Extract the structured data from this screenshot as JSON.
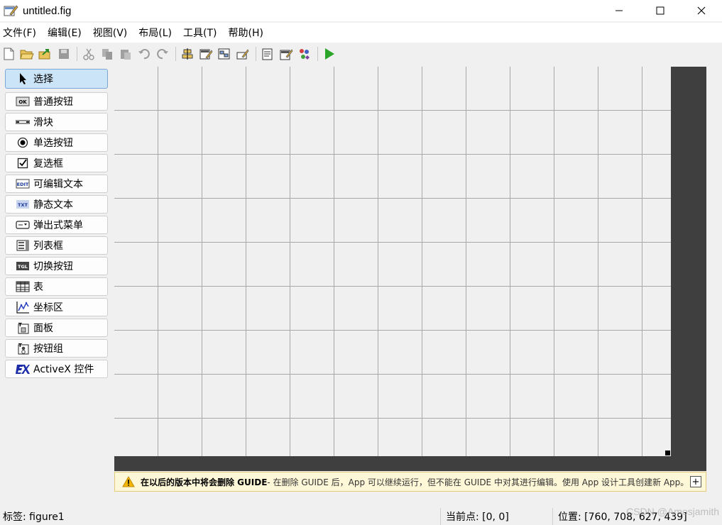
{
  "window": {
    "title": "untitled.fig"
  },
  "menu": [
    "文件(F)",
    "编辑(E)",
    "视图(V)",
    "布局(L)",
    "工具(T)",
    "帮助(H)"
  ],
  "palette": {
    "items": [
      {
        "label": "选择",
        "icon": "arrow-pointer-icon"
      },
      {
        "label": "普通按钮",
        "icon": "pushbutton-icon"
      },
      {
        "label": "滑块",
        "icon": "slider-icon"
      },
      {
        "label": "单选按钮",
        "icon": "radio-button-icon"
      },
      {
        "label": "复选框",
        "icon": "checkbox-icon"
      },
      {
        "label": "可编辑文本",
        "icon": "edit-text-icon"
      },
      {
        "label": "静态文本",
        "icon": "static-text-icon"
      },
      {
        "label": "弹出式菜单",
        "icon": "popup-menu-icon"
      },
      {
        "label": "列表框",
        "icon": "listbox-icon"
      },
      {
        "label": "切换按钮",
        "icon": "toggle-button-icon"
      },
      {
        "label": "表",
        "icon": "table-icon"
      },
      {
        "label": "坐标区",
        "icon": "axes-icon"
      },
      {
        "label": "面板",
        "icon": "panel-icon"
      },
      {
        "label": "按钮组",
        "icon": "button-group-icon"
      },
      {
        "label": "ActiveX 控件",
        "icon": "activex-icon"
      }
    ],
    "icon_text": {
      "pushbutton": "OK",
      "edit": "EDIT",
      "static": "TXT",
      "toggle": "TGL"
    }
  },
  "warning": {
    "strong": "在以后的版本中将会删除 GUIDE",
    "rest": " - 在删除 GUIDE 后，App 可以继续运行，但不能在 GUIDE 中对其进行编辑。使用 App 设计工具创建新 App。"
  },
  "status": {
    "tag": "标签: figure1",
    "current_point": "当前点: [0, 0]",
    "position": "位置: [760, 708, 627, 439]"
  },
  "watermark": "CSDN @Amosjamith",
  "colors": {
    "accent_run": "#2aa52a",
    "selected_bg": "#cce4f7",
    "warning_bg": "#fff8d8",
    "canvas_border": "#3f3f3f"
  }
}
